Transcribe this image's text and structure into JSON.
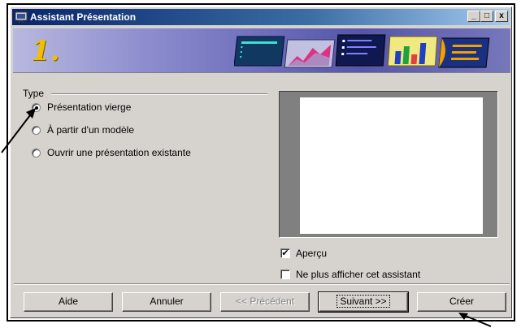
{
  "window": {
    "title": "Assistant Présentation",
    "minimize": "_",
    "maximize": "□",
    "close": "x"
  },
  "banner": {
    "step": "1."
  },
  "type_group": {
    "label": "Type",
    "options": [
      {
        "label": "Présentation vierge",
        "checked": true
      },
      {
        "label": "À partir d'un modèle",
        "checked": false
      },
      {
        "label": "Ouvrir une présentation existante",
        "checked": false
      }
    ]
  },
  "options": {
    "apercu": {
      "label": "Aperçu",
      "checked": true,
      "mark": "✔"
    },
    "ne_plus": {
      "label": "Ne plus afficher cet assistant",
      "checked": false
    }
  },
  "buttons": {
    "help": "Aide",
    "cancel": "Annuler",
    "previous": "<< Précédent",
    "next": "Suivant >>",
    "create": "Créer"
  },
  "colors": {
    "titlebar_start": "#0a246a",
    "face": "#d6d3ce",
    "step_number": "#f0c000"
  }
}
